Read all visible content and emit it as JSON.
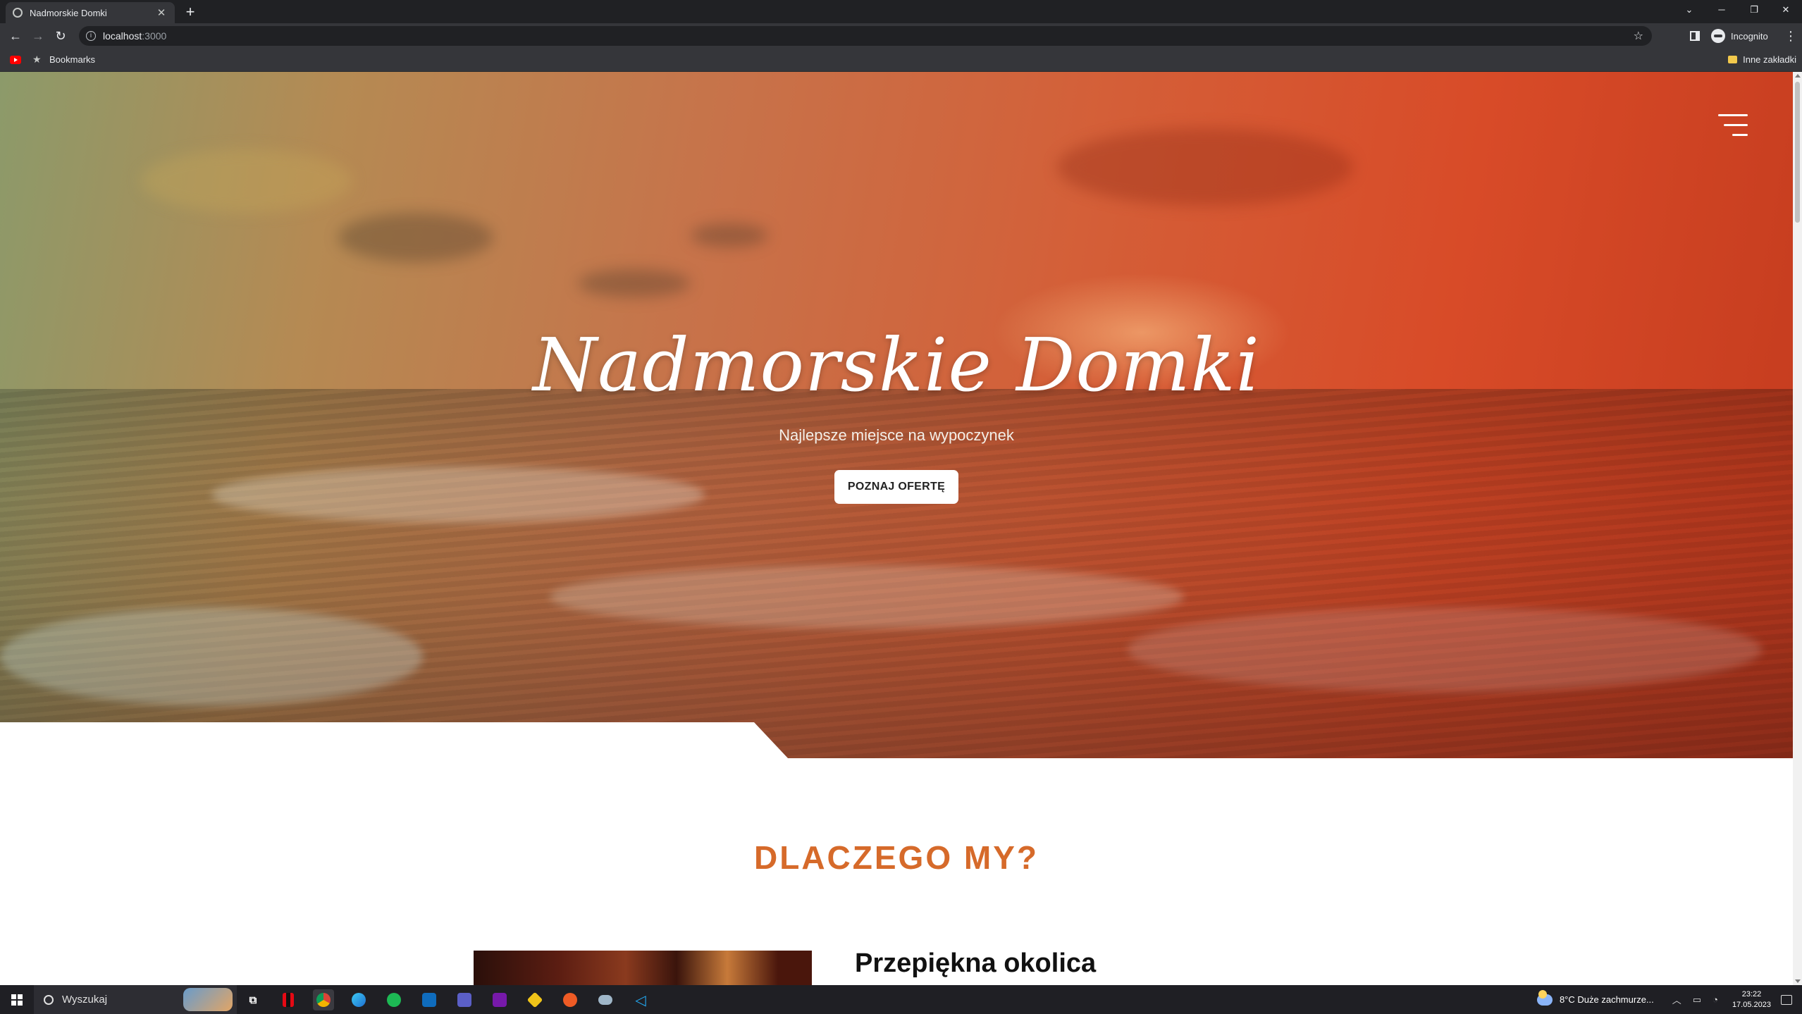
{
  "browser": {
    "tab_title": "Nadmorskie Domki",
    "new_tab_symbol": "+",
    "url_host": "localhost",
    "url_port": ":3000",
    "profile_label": "Incognito",
    "bookmarks_label": "Bookmarks",
    "other_bookmarks_label": "Inne zakładki"
  },
  "hero": {
    "title": "Nadmorskie Domki",
    "subtitle": "Najlepsze miejsce na wypoczynek",
    "cta_label": "POZNAJ OFERTĘ"
  },
  "why_us": {
    "title": "DLACZEGO MY?",
    "feature_heading": "Przepiękna okolica"
  },
  "taskbar": {
    "search_placeholder": "Wyszukaj",
    "weather": "8°C  Duże zachmurze...",
    "time": "23:22",
    "date": "17.05.2023",
    "apps": [
      "task-view",
      "netflix",
      "chrome",
      "edge-beta",
      "spotify",
      "outlook",
      "teams",
      "onenote",
      "git",
      "postman",
      "cloud-app",
      "vscode"
    ]
  },
  "colors": {
    "accent": "#d66a2a",
    "chrome_dark": "#202124",
    "chrome_mid": "#35363a"
  }
}
